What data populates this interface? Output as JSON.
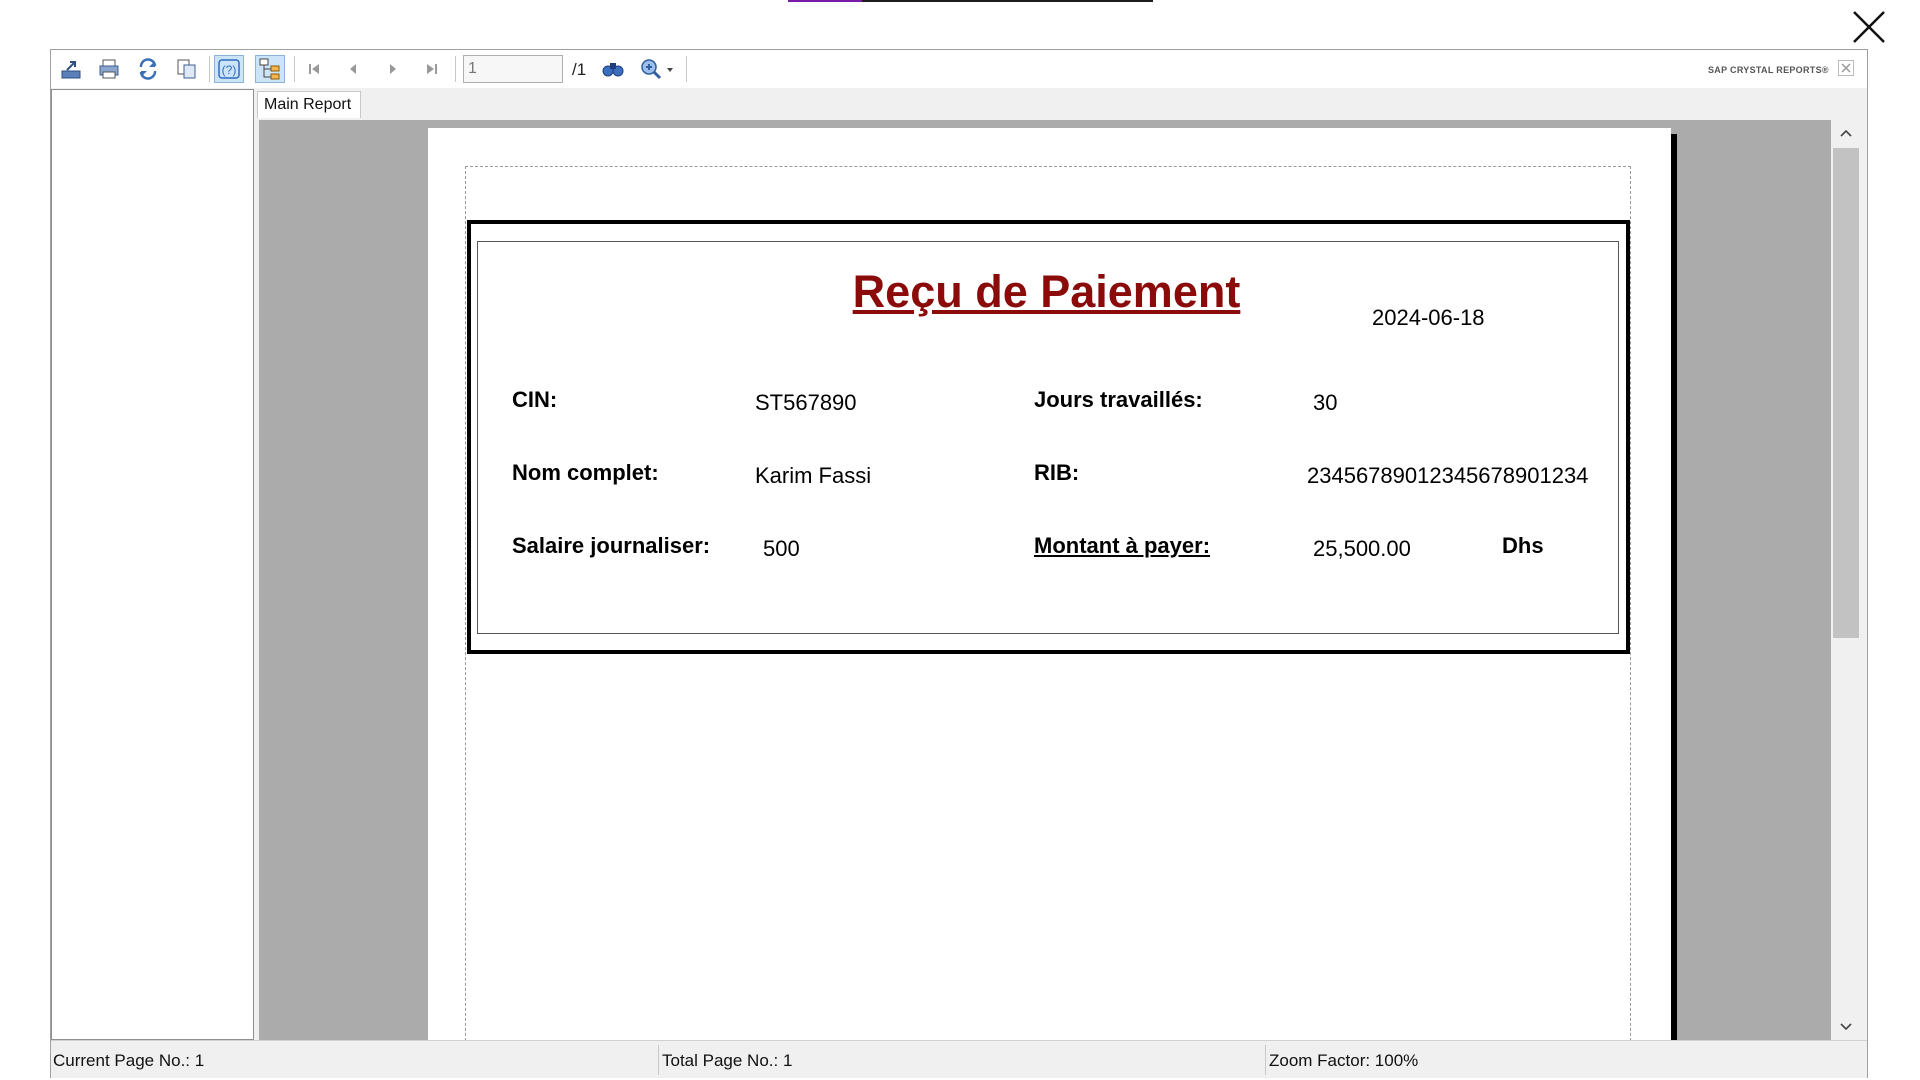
{
  "toolbar": {
    "page_input": "1",
    "page_total": "/1",
    "brand": "SAP CRYSTAL REPORTS®",
    "icons": [
      "export-icon",
      "print-icon",
      "refresh-icon",
      "copy-icon",
      "help-icon",
      "group-tree-icon",
      "first-page-icon",
      "prev-page-icon",
      "next-page-icon",
      "last-page-icon",
      "find-icon",
      "zoom-icon"
    ]
  },
  "tabs": {
    "main_report": "Main Report"
  },
  "report": {
    "title": "Reçu de Paiement",
    "date": "2024-06-18",
    "cin_label": "CIN:",
    "cin_value": "ST567890",
    "jours_label": "Jours travaillés:",
    "jours_value": "30",
    "nom_label": "Nom complet:",
    "nom_value": "Karim Fassi",
    "rib_label": "RIB:",
    "rib_value": "23456789012345678901234",
    "salaire_label": "Salaire journaliser:",
    "salaire_value": "500",
    "montant_label": "Montant à payer:",
    "montant_value": "25,500.00",
    "currency": "Dhs"
  },
  "status": {
    "current_page": "Current Page No.: 1",
    "total_page": "Total Page No.: 1",
    "zoom": "Zoom Factor: 100%"
  },
  "colors": {
    "title_color": "#8b0a0a",
    "preview_bg": "#ababab",
    "accent_purple": "#7a1aa8"
  }
}
